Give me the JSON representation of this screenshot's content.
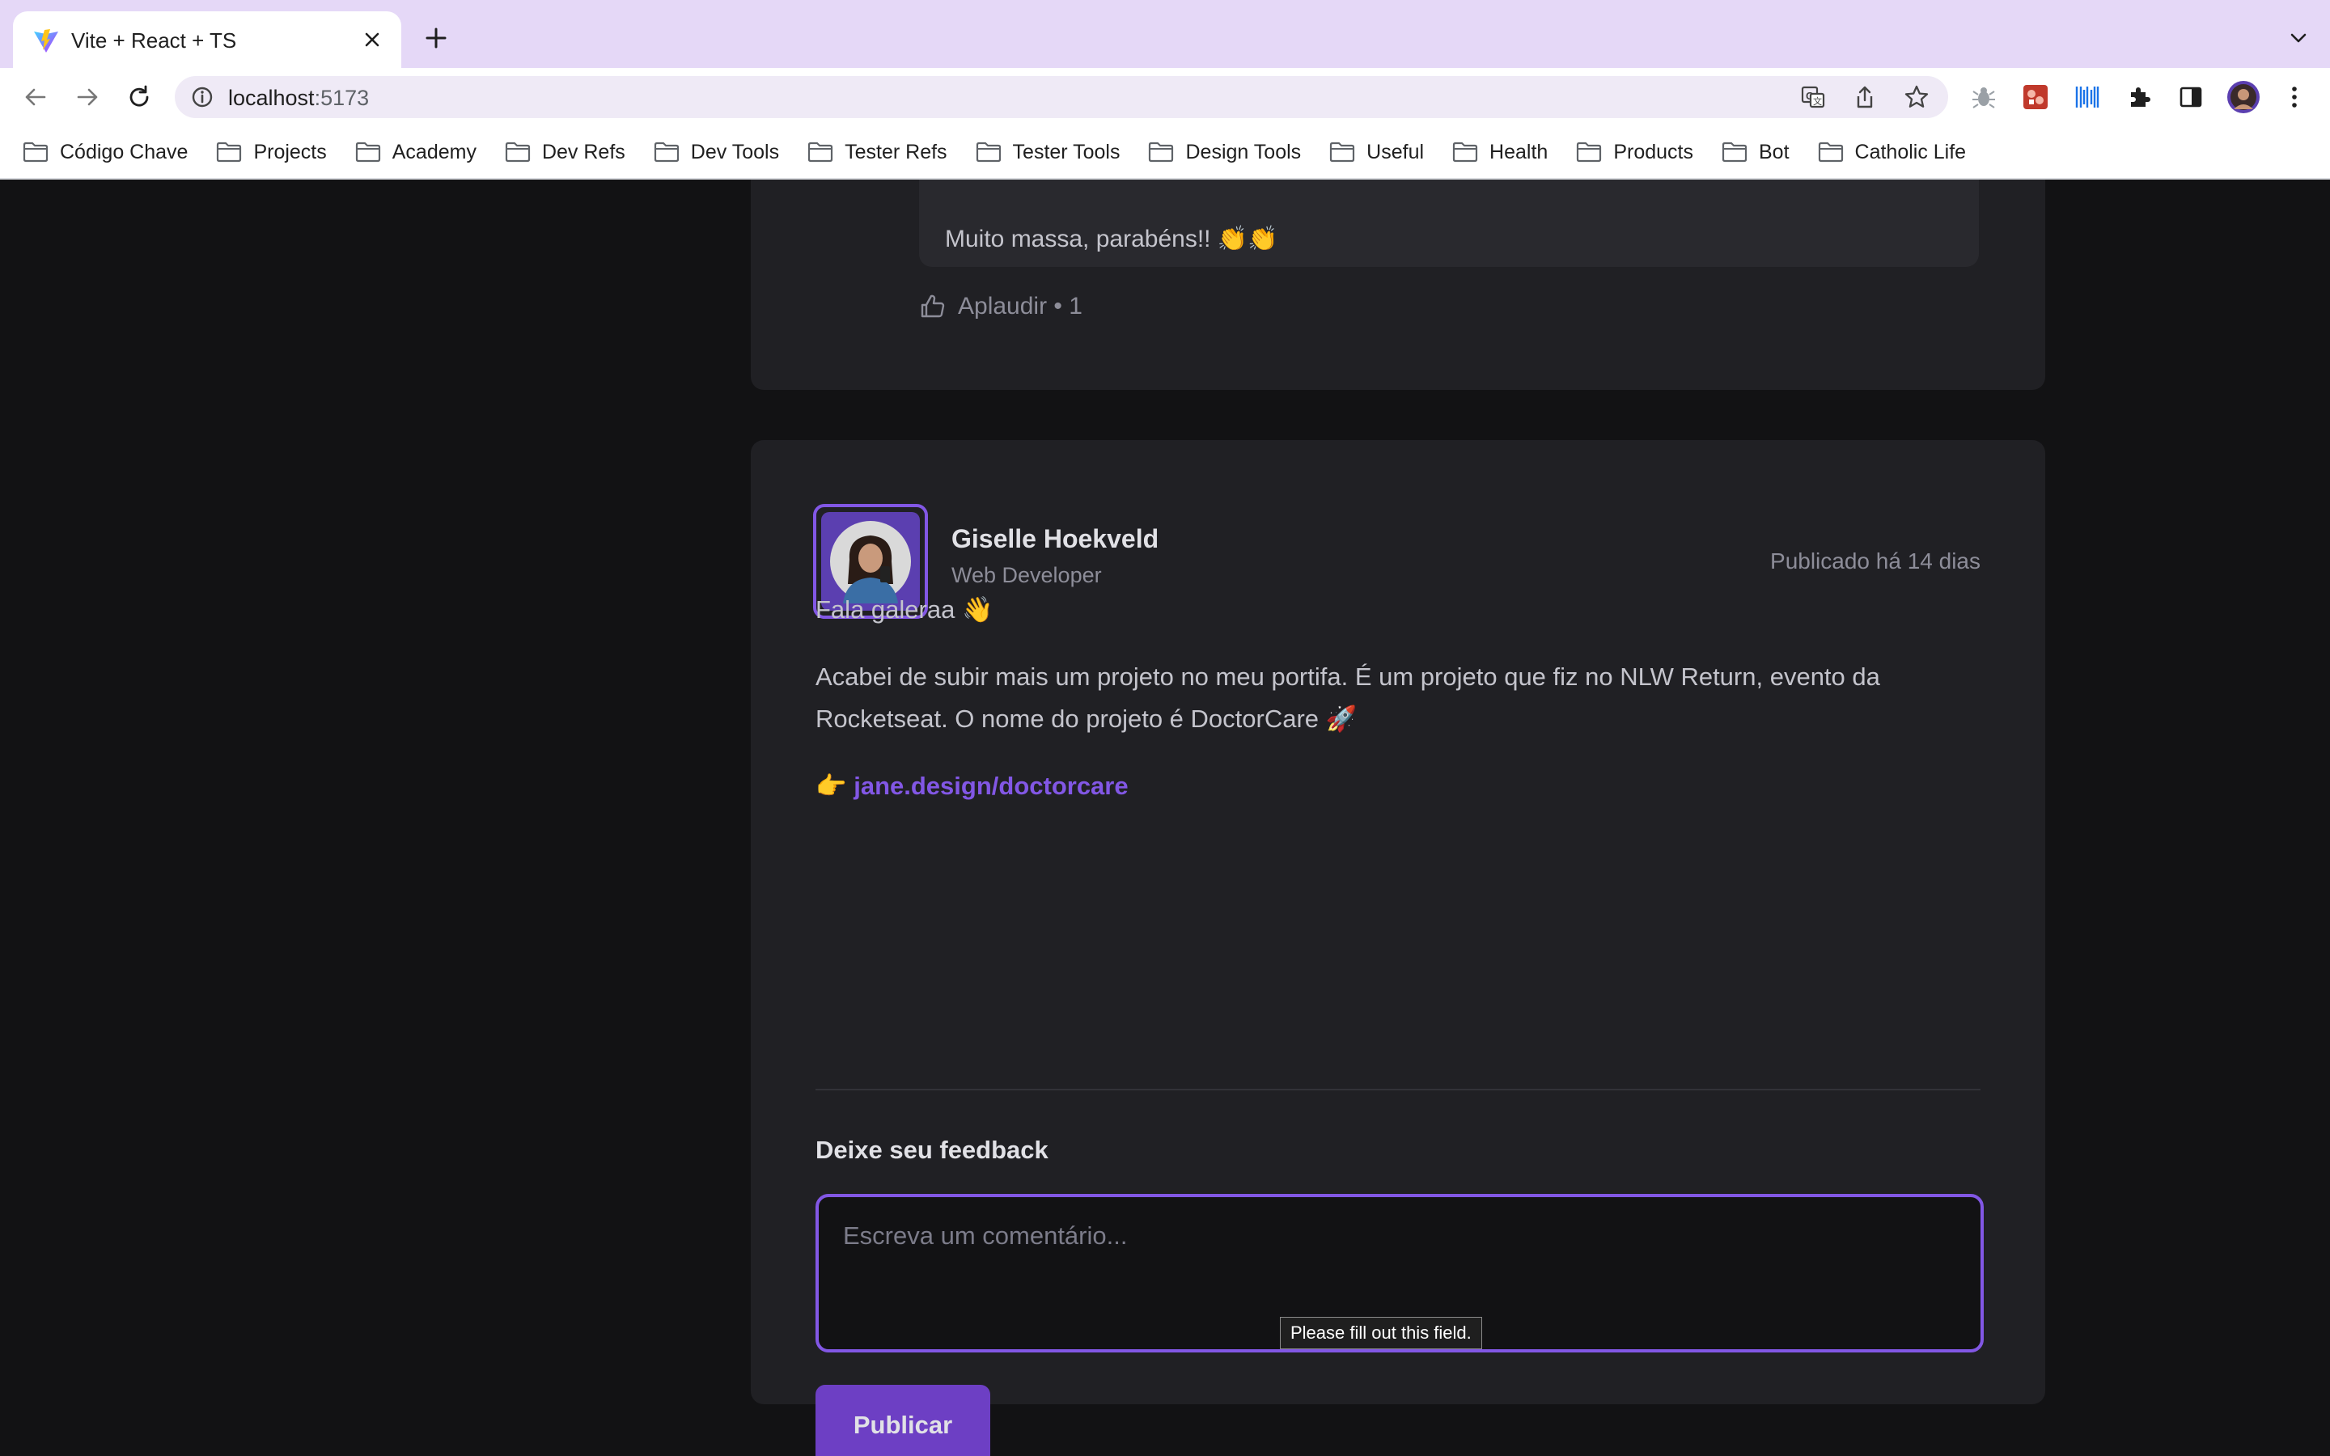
{
  "browser": {
    "tab_title": "Vite + React + TS",
    "url_host": "localhost",
    "url_port": ":5173",
    "bookmarks": [
      "Código Chave",
      "Projects",
      "Academy",
      "Dev Refs",
      "Dev Tools",
      "Tester Refs",
      "Tester Tools",
      "Design Tools",
      "Useful",
      "Health",
      "Products",
      "Bot",
      "Catholic Life"
    ]
  },
  "previous_post": {
    "comment_text": "Muito massa, parabéns!! 👏👏",
    "applaud_label": "Aplaudir",
    "applaud_separator": " • ",
    "applaud_count": "1"
  },
  "post": {
    "author_name": "Giselle Hoekveld",
    "author_role": "Web Developer",
    "published": "Publicado há 14 dias",
    "greeting": "Fala galeraa 👋",
    "paragraph_line1": "Acabei de subir mais um projeto no meu portifa. É um projeto que fiz no NLW Return, evento da",
    "paragraph_line2": "Rocketseat. O nome do projeto é DoctorCare 🚀",
    "link_prefix": "👉 ",
    "link_text": "jane.design/doctorcare",
    "feedback_title": "Deixe seu feedback",
    "comment_placeholder": "Escreva um comentário...",
    "validation_tooltip": "Please fill out this field.",
    "publish_label": "Publicar"
  },
  "colors": {
    "accent": "#8257e5",
    "page_background": "#121214",
    "card_background": "#202024",
    "tabstrip": "#e5d8f7"
  }
}
